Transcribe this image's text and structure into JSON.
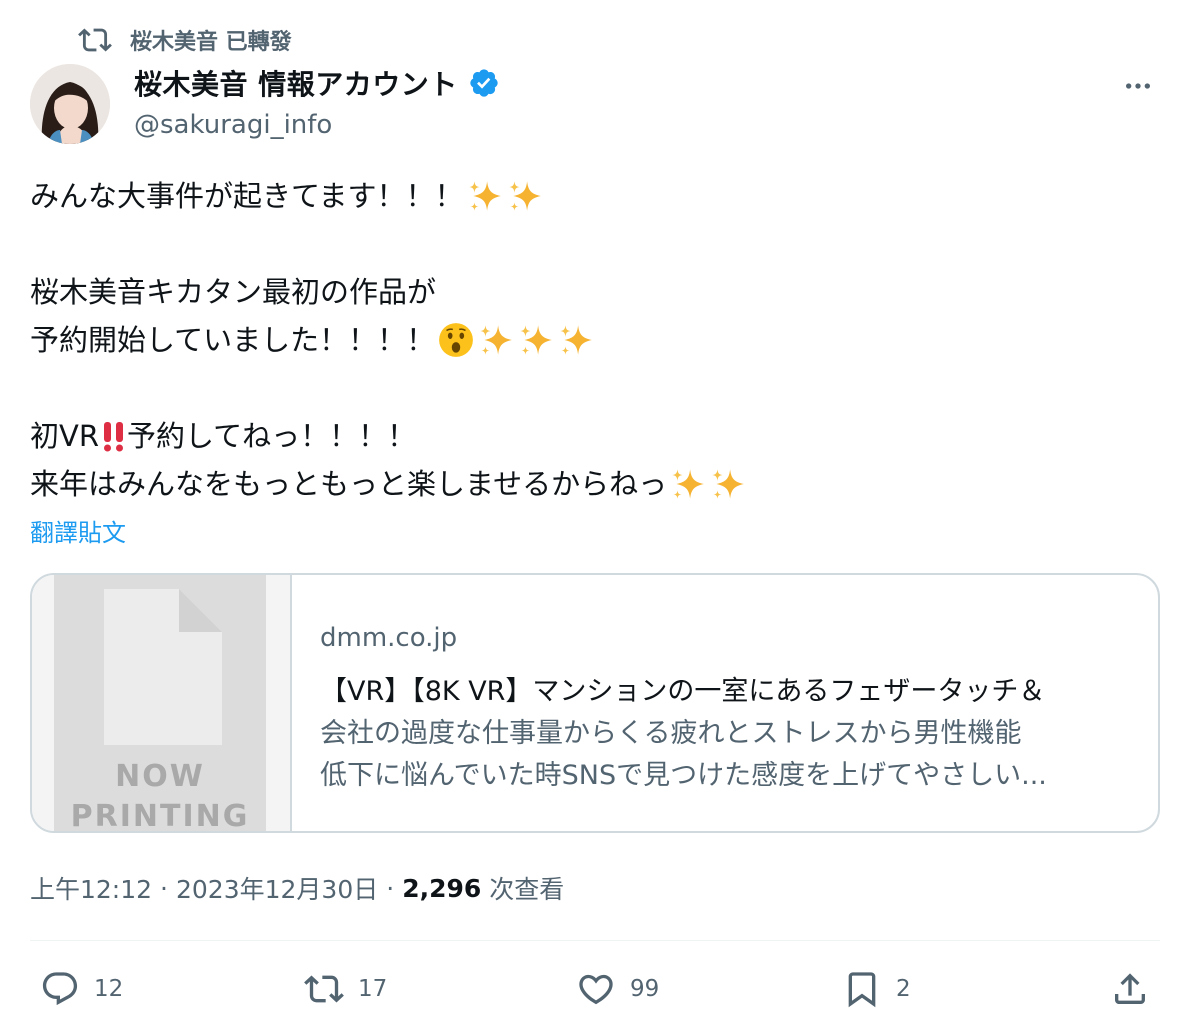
{
  "repost": {
    "text": "桜木美音 已轉發",
    "icon": "repost-icon"
  },
  "author": {
    "display_name": "桜木美音 情報アカウント",
    "handle": "@sakuragi_info",
    "verified": true,
    "verified_color": "#1d9bf0"
  },
  "tweet": {
    "lines": [
      "みんな大事件が起きてます！！！",
      "",
      "桜木美音キカタン最初の作品が",
      "予約開始していました！！！！",
      "",
      "初VR",
      "予約してねっ！！！！",
      "来年はみんなをもっともっと楽しませるからねっ"
    ],
    "emoji": {
      "line1": [
        "sparkles",
        "sparkles"
      ],
      "line4": [
        "hushed-face",
        "sparkles",
        "sparkles",
        "sparkles"
      ],
      "line6": [
        "double-exclamation"
      ],
      "line8": [
        "sparkles",
        "sparkles"
      ]
    },
    "translate_label": "翻譯貼文"
  },
  "card": {
    "thumb_text_1": "NOW",
    "thumb_text_2": "PRINTING",
    "domain": "dmm.co.jp",
    "title": "【VR】【8K VR】マンションの一室にあるフェザータッチ＆",
    "desc_line1": "会社の過度な仕事量からくる疲れとストレスから男性機能",
    "desc_line2": "低下に悩んでいた時SNSで見つけた感度を上げてやさしい..."
  },
  "meta": {
    "time": "上午12:12",
    "sep1": "·",
    "date": "2023年12月30日",
    "sep2": "·",
    "views": "2,296",
    "views_label": "次查看"
  },
  "actions": {
    "reply_count": "12",
    "repost_count": "17",
    "like_count": "99",
    "bookmark_count": "2"
  },
  "colors": {
    "text": "#0f1419",
    "secondary": "#536471",
    "link": "#1d9bf0",
    "border": "#cfd9de",
    "sparkle": "#f5b331"
  }
}
